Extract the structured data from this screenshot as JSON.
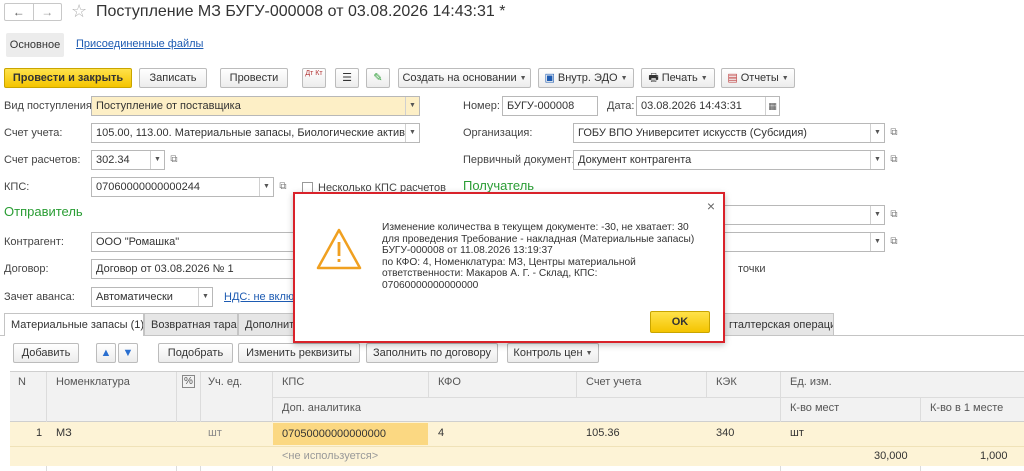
{
  "window": {
    "title": "Поступление МЗ БУГУ-000008 от 03.08.2026 14:43:31 *",
    "nav_back": "←",
    "nav_forward": "→"
  },
  "form_tabs": {
    "main": "Основное",
    "attached": "Присоединенные файлы"
  },
  "toolbar": {
    "post_close": "Провести и закрыть",
    "save": "Записать",
    "post": "Провести",
    "dt_kt": "Дт Кт",
    "create_based_on": "Создать на основании",
    "internal_edo": "Внутр. ЭДО",
    "print": "Печать",
    "reports": "Отчеты"
  },
  "form": {
    "receipt_type_label": "Вид поступления:",
    "receipt_type_value": "Поступление от поставщика",
    "account_label": "Счет учета:",
    "account_value": "105.00, 113.00. Материальные запасы, Биологические активы",
    "settlement_label": "Счет расчетов:",
    "settlement_value": "302.34",
    "kps_label": "КПС:",
    "kps_value": "07060000000000244",
    "several_kps_label": "Несколько КПС расчетов",
    "sender_section": "Отправитель",
    "counterparty_label": "Контрагент:",
    "counterparty_value": "ООО \"Ромашка\"",
    "contract_label": "Договор:",
    "contract_value": "Договор от 03.08.2026 № 1",
    "advance_label": "Зачет аванса:",
    "advance_value": "Автоматически",
    "vat_link": "НДС: не включ",
    "number_label": "Номер:",
    "number_value": "БУГУ-000008",
    "date_label": "Дата:",
    "date_value": "03.08.2026 14:43:31",
    "org_label": "Организация:",
    "org_value": "ГОБУ ВПО Университет искусств (Субсидия)",
    "primary_doc_label": "Первичный документ:",
    "primary_doc_value": "Документ контрагента",
    "recipient_section": "Получатель",
    "points_fragment": "точки"
  },
  "bottom_tabs": [
    "Материальные запасы (1)",
    "Возвратная тара",
    "Дополнит",
    "гталтерская операция"
  ],
  "table_toolbar": {
    "add": "Добавить",
    "pick": "Подобрать",
    "change_props": "Изменить реквизиты",
    "fill_contract": "Заполнить по договору",
    "price_control": "Контроль цен"
  },
  "table": {
    "headers": {
      "n": "N",
      "nomenclature": "Номенклатура",
      "pct": "%",
      "unit": "Уч. ед.",
      "kps": "КПС",
      "kfo": "КФО",
      "account": "Счет учета",
      "kek": "КЭК",
      "unit_measure": "Ед. изм.",
      "extra_analytics": "Доп. аналитика",
      "qty_places": "К-во мест",
      "qty_per_place": "К-во в 1 месте"
    },
    "rows": [
      {
        "n": "1",
        "nomenclature": "МЗ",
        "unit": "шт",
        "kps": "07050000000000000",
        "kfo": "4",
        "account": "105.36",
        "kek": "340",
        "unit_measure": "шт",
        "extra_analytics": "<не используется>",
        "qty_places": "30,000",
        "qty_per_place": "1,000"
      }
    ]
  },
  "dialog": {
    "message": "Изменение количества в текущем документе: -30, не хватает: 30\nдля проведения Требование - накладная (Материальные запасы)\nБУГУ-000008 от 11.08.2026 13:19:37\nпо КФО: 4, Номенклатура: МЗ, Центры материальной\nответственности: Макаров А. Г. - Склад, КПС:\n07060000000000000",
    "ok": "OK",
    "close": "×"
  },
  "colors": {
    "accent_yellow": "#f4c400",
    "section_green": "#2a9d34",
    "link_blue": "#1d5bb2",
    "dialog_border": "#d9222a",
    "warning_orange": "#f0a020"
  }
}
